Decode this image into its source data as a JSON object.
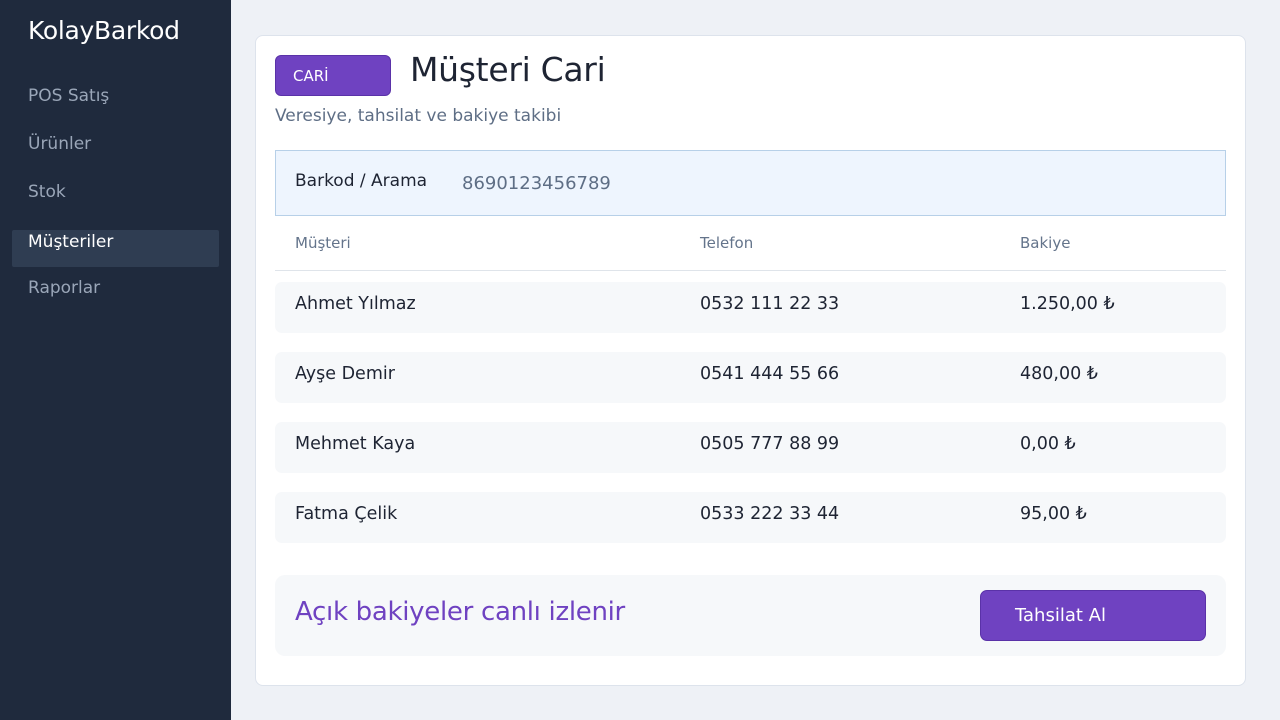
{
  "app": {
    "brand": "KolayBarkod"
  },
  "sidebar": {
    "items": [
      {
        "label": "POS Satış"
      },
      {
        "label": "Ürünler"
      },
      {
        "label": "Stok"
      },
      {
        "label": "Müşteriler",
        "active": true
      },
      {
        "label": "Raporlar"
      }
    ]
  },
  "header": {
    "badge": "CARİ",
    "title": "Müşteri Cari",
    "subtitle": "Veresiye, tahsilat ve bakiye takibi"
  },
  "search": {
    "label": "Barkod / Arama",
    "value": "8690123456789"
  },
  "table": {
    "columns": [
      "Müşteri",
      "Telefon",
      "Bakiye"
    ],
    "rows": [
      {
        "name": "Ahmet Yılmaz",
        "phone": "0532 111 22 33",
        "balance": "1.250,00 ₺"
      },
      {
        "name": "Ayşe Demir",
        "phone": "0541 444 55 66",
        "balance": "480,00 ₺"
      },
      {
        "name": "Mehmet Kaya",
        "phone": "0505 777 88 99",
        "balance": "0,00 ₺"
      },
      {
        "name": "Fatma Çelik",
        "phone": "0533 222 33 44",
        "balance": "95,00 ₺"
      }
    ]
  },
  "footer": {
    "status_text": "Açık bakiyeler canlı izlenir",
    "collect_button": "Tahsilat Al"
  },
  "colors": {
    "sidebar_bg": "#1f2a3d",
    "accent": "#6f42c1",
    "page_bg": "#eef1f6"
  }
}
